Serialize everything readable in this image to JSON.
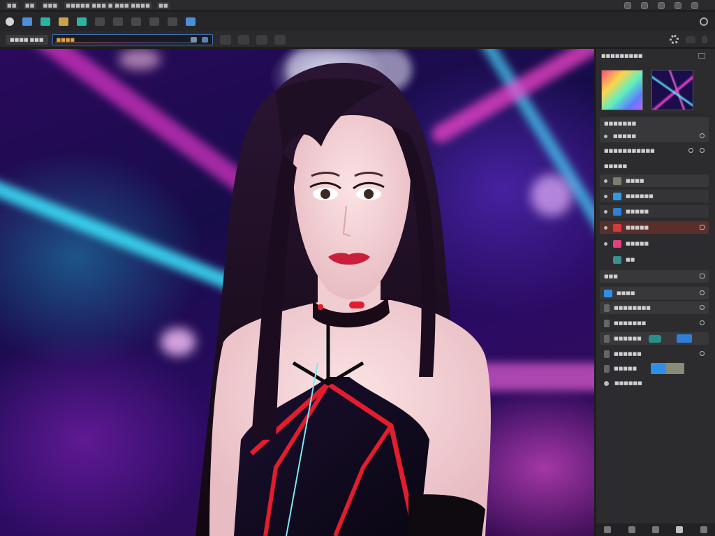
{
  "menubar": {
    "items": [
      "■■",
      "■■",
      "■■■",
      "■■■■■ ■■■ ■ ■■■ ■■■■",
      "■■"
    ],
    "right_icons": [
      "shield-icon",
      "cloud-icon",
      "globe-icon",
      "help-icon",
      "settings-icon"
    ]
  },
  "toolbar": {
    "tools": [
      "move-tool",
      "select-tool",
      "crop-tool",
      "brush-tool",
      "clone-tool",
      "text-tool",
      "shape-tool",
      "layers-tool",
      "mask-tool",
      "filter-tool",
      "adjust-tool"
    ],
    "accent": "#2bb3a4"
  },
  "options": {
    "label": "■■■■ ■■■",
    "field_value": "■■■■",
    "accent": "#3d6fb8"
  },
  "panel": {
    "title": "■■■■■■■■■",
    "rows": [
      {
        "label": "■■■■■■■"
      },
      {
        "label": "■■■■■"
      },
      {
        "label": "■■■■■■■■■■■"
      },
      {
        "label": "■■■■■"
      },
      {
        "label": "■■■■"
      },
      {
        "label": "■■■■■■"
      },
      {
        "label": "■■■■■"
      },
      {
        "label": "■■■■■"
      },
      {
        "label": "■■■■■"
      },
      {
        "label": "■■"
      },
      {
        "label": "■■■"
      },
      {
        "label": "■■■■"
      },
      {
        "label": "■■■■■■■■"
      },
      {
        "label": "■■■■■■■"
      },
      {
        "label": "■■■■■■"
      },
      {
        "label": "■■■■■■"
      },
      {
        "label": "■■■■■"
      },
      {
        "label": "■■■■■■"
      }
    ],
    "colors": {
      "selected_row": "#5a2f2b",
      "layer_blue": "#2f7fd6",
      "layer_red": "#d33b3b",
      "layer_pink": "#e0407f"
    }
  },
  "canvas": {
    "subject": "portrait-of-woman-with-long-dark-hair-in-black-and-red-outfit",
    "background": "neon-stage-lights-purple-cyan-magenta"
  }
}
